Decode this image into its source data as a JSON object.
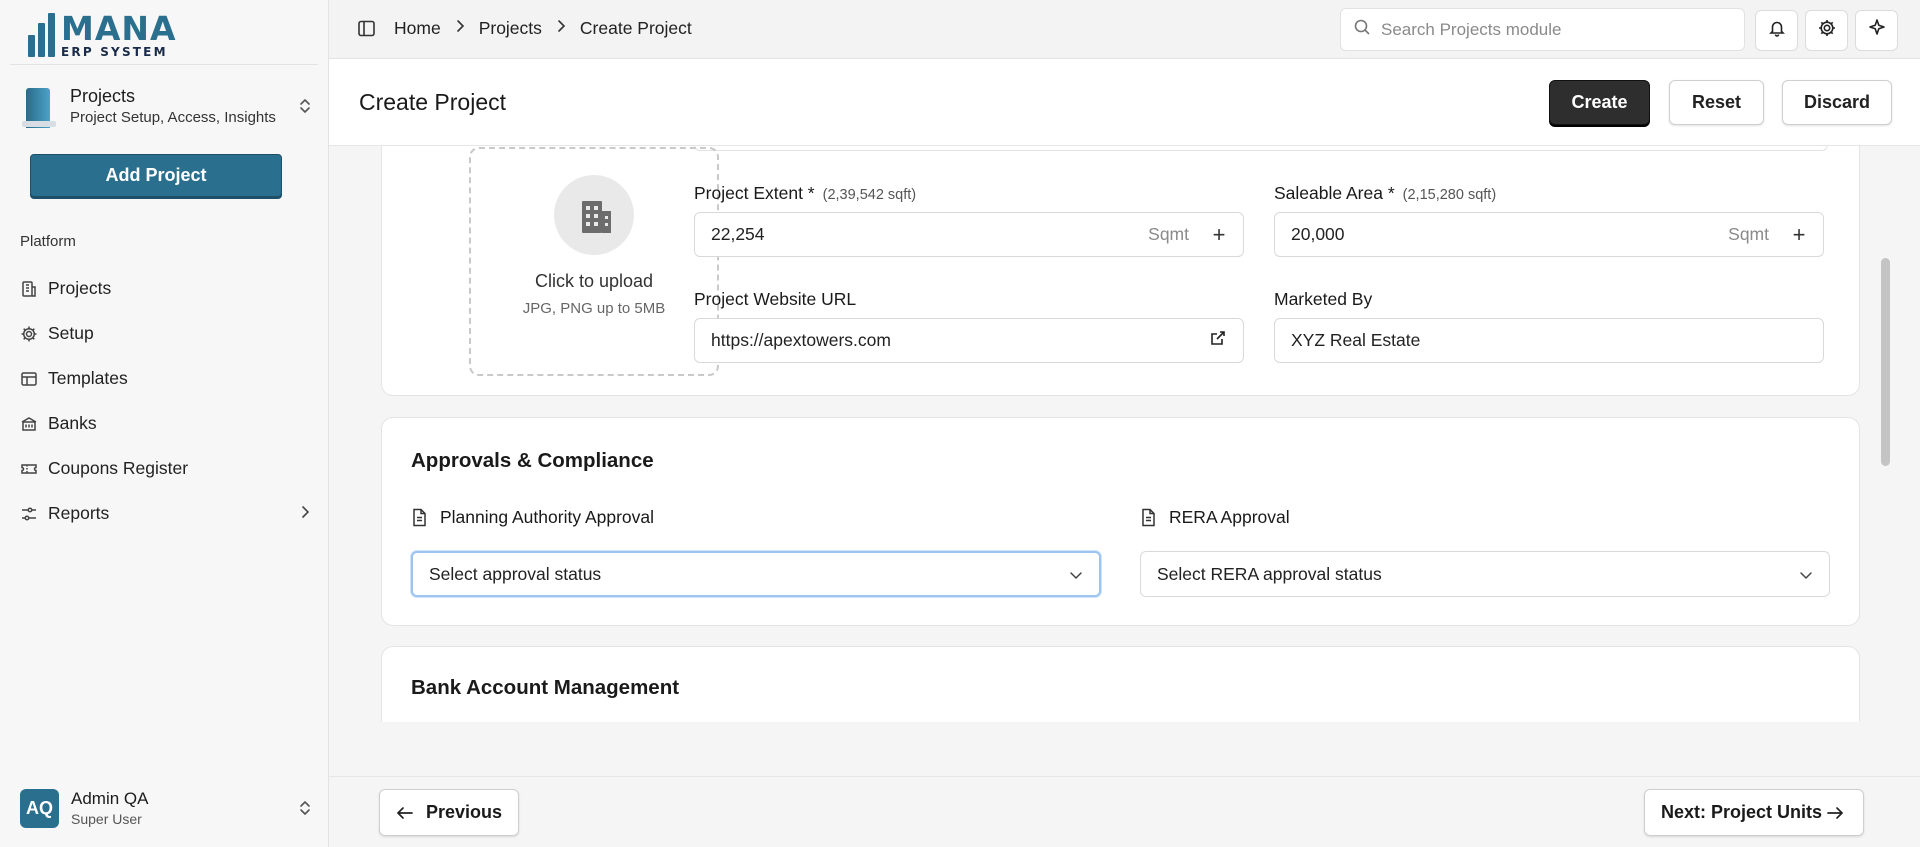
{
  "brand": {
    "name": "MANA",
    "subtitle": "ERP SYSTEM",
    "color": "#2b6f8f"
  },
  "module": {
    "title": "Projects",
    "description": "Project Setup, Access, Insights"
  },
  "sidebar": {
    "add_button": "Add Project",
    "group_label": "Platform",
    "items": [
      {
        "label": "Projects",
        "icon": "building-icon"
      },
      {
        "label": "Setup",
        "icon": "gear-icon"
      },
      {
        "label": "Templates",
        "icon": "layout-icon"
      },
      {
        "label": "Banks",
        "icon": "bank-icon"
      },
      {
        "label": "Coupons Register",
        "icon": "ticket-icon"
      },
      {
        "label": "Reports",
        "icon": "sliders-icon",
        "has_submenu": true
      }
    ]
  },
  "user": {
    "initials": "AQ",
    "name": "Admin QA",
    "role": "Super User"
  },
  "breadcrumb": [
    "Home",
    "Projects",
    "Create Project"
  ],
  "search": {
    "placeholder": "Search Projects module"
  },
  "header": {
    "title": "Create Project",
    "create_label": "Create",
    "reset_label": "Reset",
    "discard_label": "Discard"
  },
  "project_details": {
    "upload_title": "Click to upload",
    "upload_hint": "JPG, PNG up to 5MB",
    "extent": {
      "label": "Project Extent *",
      "hint": "(2,39,542 sqft)",
      "value": "22,254",
      "unit": "Sqmt"
    },
    "saleable": {
      "label": "Saleable Area *",
      "hint": "(2,15,280 sqft)",
      "value": "20,000",
      "unit": "Sqmt"
    },
    "website": {
      "label": "Project Website URL",
      "value": "https://apextowers.com"
    },
    "marketed_by": {
      "label": "Marketed By",
      "value": "XYZ Real Estate"
    }
  },
  "approvals": {
    "title": "Approvals & Compliance",
    "planning": {
      "label": "Planning Authority Approval",
      "value": "Select approval status"
    },
    "rera": {
      "label": "RERA Approval",
      "value": "Select RERA approval status"
    }
  },
  "bank_section": {
    "title": "Bank Account Management"
  },
  "footer": {
    "previous_label": "Previous",
    "next_label": "Next: Project Units"
  }
}
